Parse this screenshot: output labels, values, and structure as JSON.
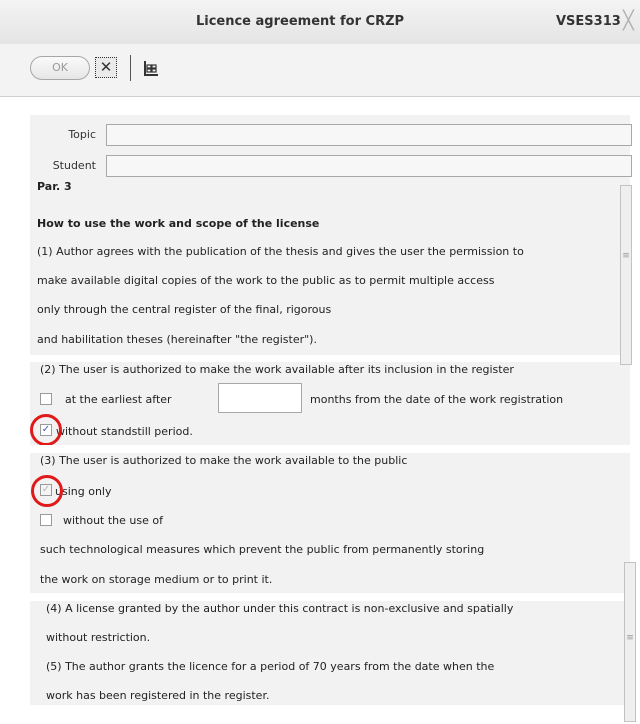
{
  "window": {
    "title": "Licence agreement for CRZP",
    "code": "VSES313",
    "close_glyph": "╳"
  },
  "toolbar": {
    "ok_label": "OK",
    "cancel_glyph": "✕"
  },
  "form": {
    "topic_label": "Topic",
    "topic_value": "",
    "student_label": "Student",
    "student_value": ""
  },
  "document": {
    "paragraph": "Par. 3",
    "heading": "How to use the work and scope of the license",
    "lines": [
      "(1) Author agrees with the publication of the thesis and gives the user the permission to",
      "make available digital copies of the work to the public as to permit multiple access",
      "only through the central register of the final, rigorous",
      "and habilitation theses (hereinafter \"the register\").",
      "(2) The user is authorized to make the work available after its inclusion in the register"
    ],
    "option_earliest_prefix": "at the earliest after",
    "option_earliest_months_value": "",
    "option_earliest_suffix": "months from the date of the work registration",
    "option_earliest_checked": false,
    "option_without_standstill": "without standstill period.",
    "option_without_standstill_checked": true,
    "line3": "(3) The user is authorized to make the work available to the public",
    "option_using_only": "using only",
    "option_using_only_checked": true,
    "option_without_use": "without the use of",
    "option_without_use_checked": false,
    "line_tech1": "such technological measures which prevent the public from permanently storing",
    "line_tech2": "the work on storage medium or to print it.",
    "line4a": "(4) A license granted by the author under this contract is non-exclusive and spatially",
    "line4b": "without restriction.",
    "line5a": "(5) The author grants the licence for a period of 70 years from the date when the",
    "line5b": "work has been registered in the register."
  },
  "colors": {
    "highlight_circle": "#e01a1a",
    "checkbox_check": "#3a5dbf"
  }
}
